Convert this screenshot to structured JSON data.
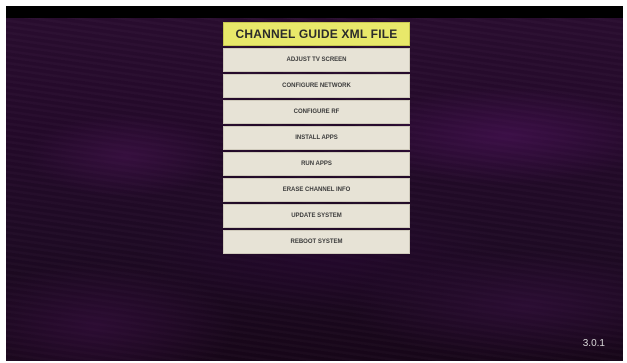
{
  "menu": {
    "title": "CHANNEL GUIDE XML FILE",
    "items": [
      {
        "label": "ADJUST TV SCREEN"
      },
      {
        "label": "CONFIGURE NETWORK"
      },
      {
        "label": "CONFIGURE RF"
      },
      {
        "label": "INSTALL APPS"
      },
      {
        "label": "RUN APPS"
      },
      {
        "label": "ERASE CHANNEL INFO"
      },
      {
        "label": "UPDATE SYSTEM"
      },
      {
        "label": "REBOOT SYSTEM"
      }
    ]
  },
  "footer": {
    "version": "3.0.1"
  },
  "colors": {
    "title_bg": "#e8e86a",
    "item_bg": "#e7e3d6",
    "background": "#24092a"
  }
}
